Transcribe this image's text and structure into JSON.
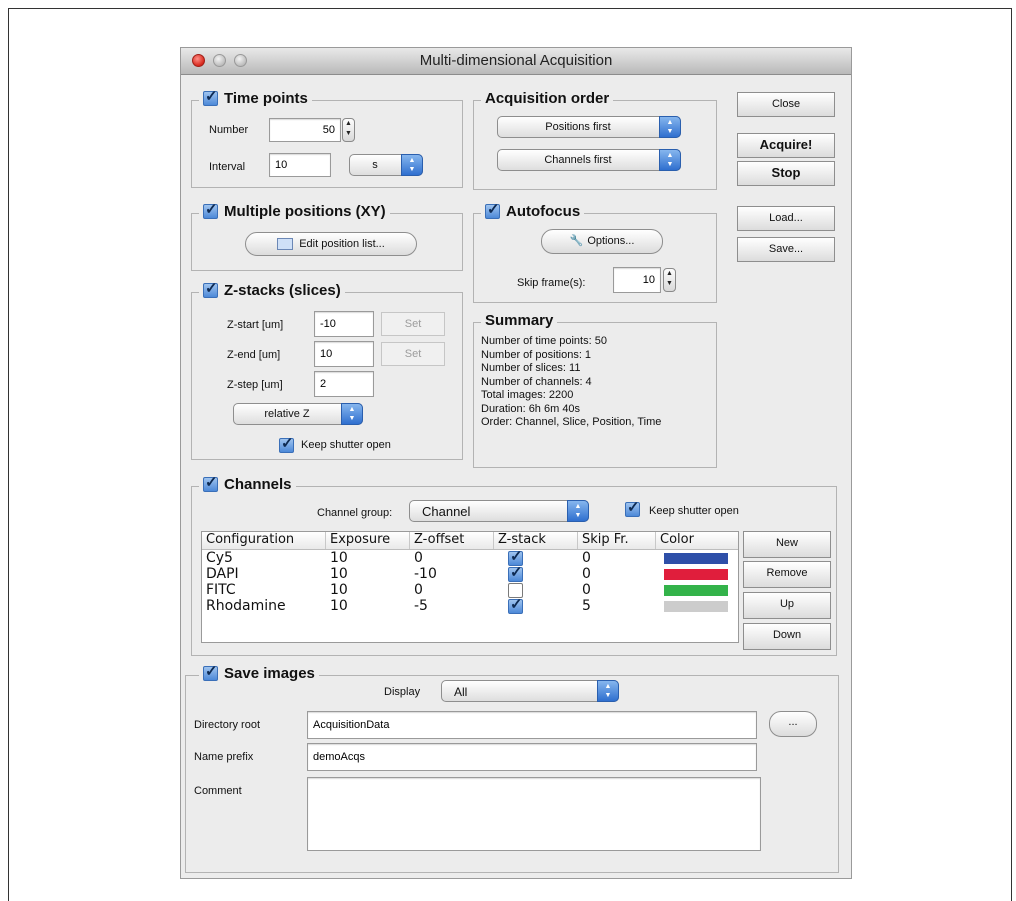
{
  "window": {
    "title": "Multi-dimensional Acquisition"
  },
  "time_points": {
    "title": "Time points",
    "enabled": true,
    "number_label": "Number",
    "number_value": "50",
    "interval_label": "Interval",
    "interval_value": "10",
    "interval_unit": "s"
  },
  "acquisition_order": {
    "title": "Acquisition order",
    "order1": "Positions first",
    "order2": "Channels first"
  },
  "buttons": {
    "close": "Close",
    "acquire": "Acquire!",
    "stop": "Stop",
    "load": "Load...",
    "save": "Save..."
  },
  "positions": {
    "title": "Multiple positions (XY)",
    "enabled": true,
    "edit_button": "Edit position list..."
  },
  "autofocus": {
    "title": "Autofocus",
    "enabled": true,
    "options_button": "Options...",
    "skip_label": "Skip frame(s):",
    "skip_value": "10"
  },
  "zstacks": {
    "title": "Z-stacks (slices)",
    "enabled": true,
    "start_label": "Z-start [um]",
    "start_value": "-10",
    "end_label": "Z-end [um]",
    "end_value": "10",
    "step_label": "Z-step [um]",
    "step_value": "2",
    "set_label": "Set",
    "mode": "relative Z",
    "keep_shutter_label": "Keep shutter open",
    "keep_shutter": true
  },
  "summary": {
    "title": "Summary",
    "lines": [
      "Number of time points: 50",
      "Number of positions: 1",
      "Number of slices: 11",
      "Number of channels: 4",
      "Total images: 2200",
      "Duration: 6h 6m 40s",
      "Order: Channel, Slice, Position, Time"
    ]
  },
  "channels": {
    "title": "Channels",
    "enabled": true,
    "group_label": "Channel group:",
    "group_value": "Channel",
    "keep_shutter_label": "Keep shutter open",
    "keep_shutter": true,
    "columns": [
      "Configuration",
      "Exposure",
      "Z-offset",
      "Z-stack",
      "Skip Fr.",
      "Color"
    ],
    "rows": [
      {
        "config": "Cy5",
        "exposure": "10",
        "zoffset": "0",
        "zstack": true,
        "skip": "0",
        "color": "#2e4fa8"
      },
      {
        "config": "DAPI",
        "exposure": "10",
        "zoffset": "-10",
        "zstack": true,
        "skip": "0",
        "color": "#e01e3c"
      },
      {
        "config": "FITC",
        "exposure": "10",
        "zoffset": "0",
        "zstack": false,
        "skip": "0",
        "color": "#33b34a"
      },
      {
        "config": "Rhodamine",
        "exposure": "10",
        "zoffset": "-5",
        "zstack": true,
        "skip": "5",
        "color": "#cccccc"
      }
    ],
    "buttons": {
      "new": "New",
      "remove": "Remove",
      "up": "Up",
      "down": "Down"
    }
  },
  "save_images": {
    "title": "Save images",
    "enabled": true,
    "display_label": "Display",
    "display_value": "All",
    "dir_label": "Directory root",
    "dir_value": "AcquisitionData",
    "browse_label": "...",
    "prefix_label": "Name prefix",
    "prefix_value": "demoAcqs",
    "comment_label": "Comment",
    "comment_value": ""
  }
}
